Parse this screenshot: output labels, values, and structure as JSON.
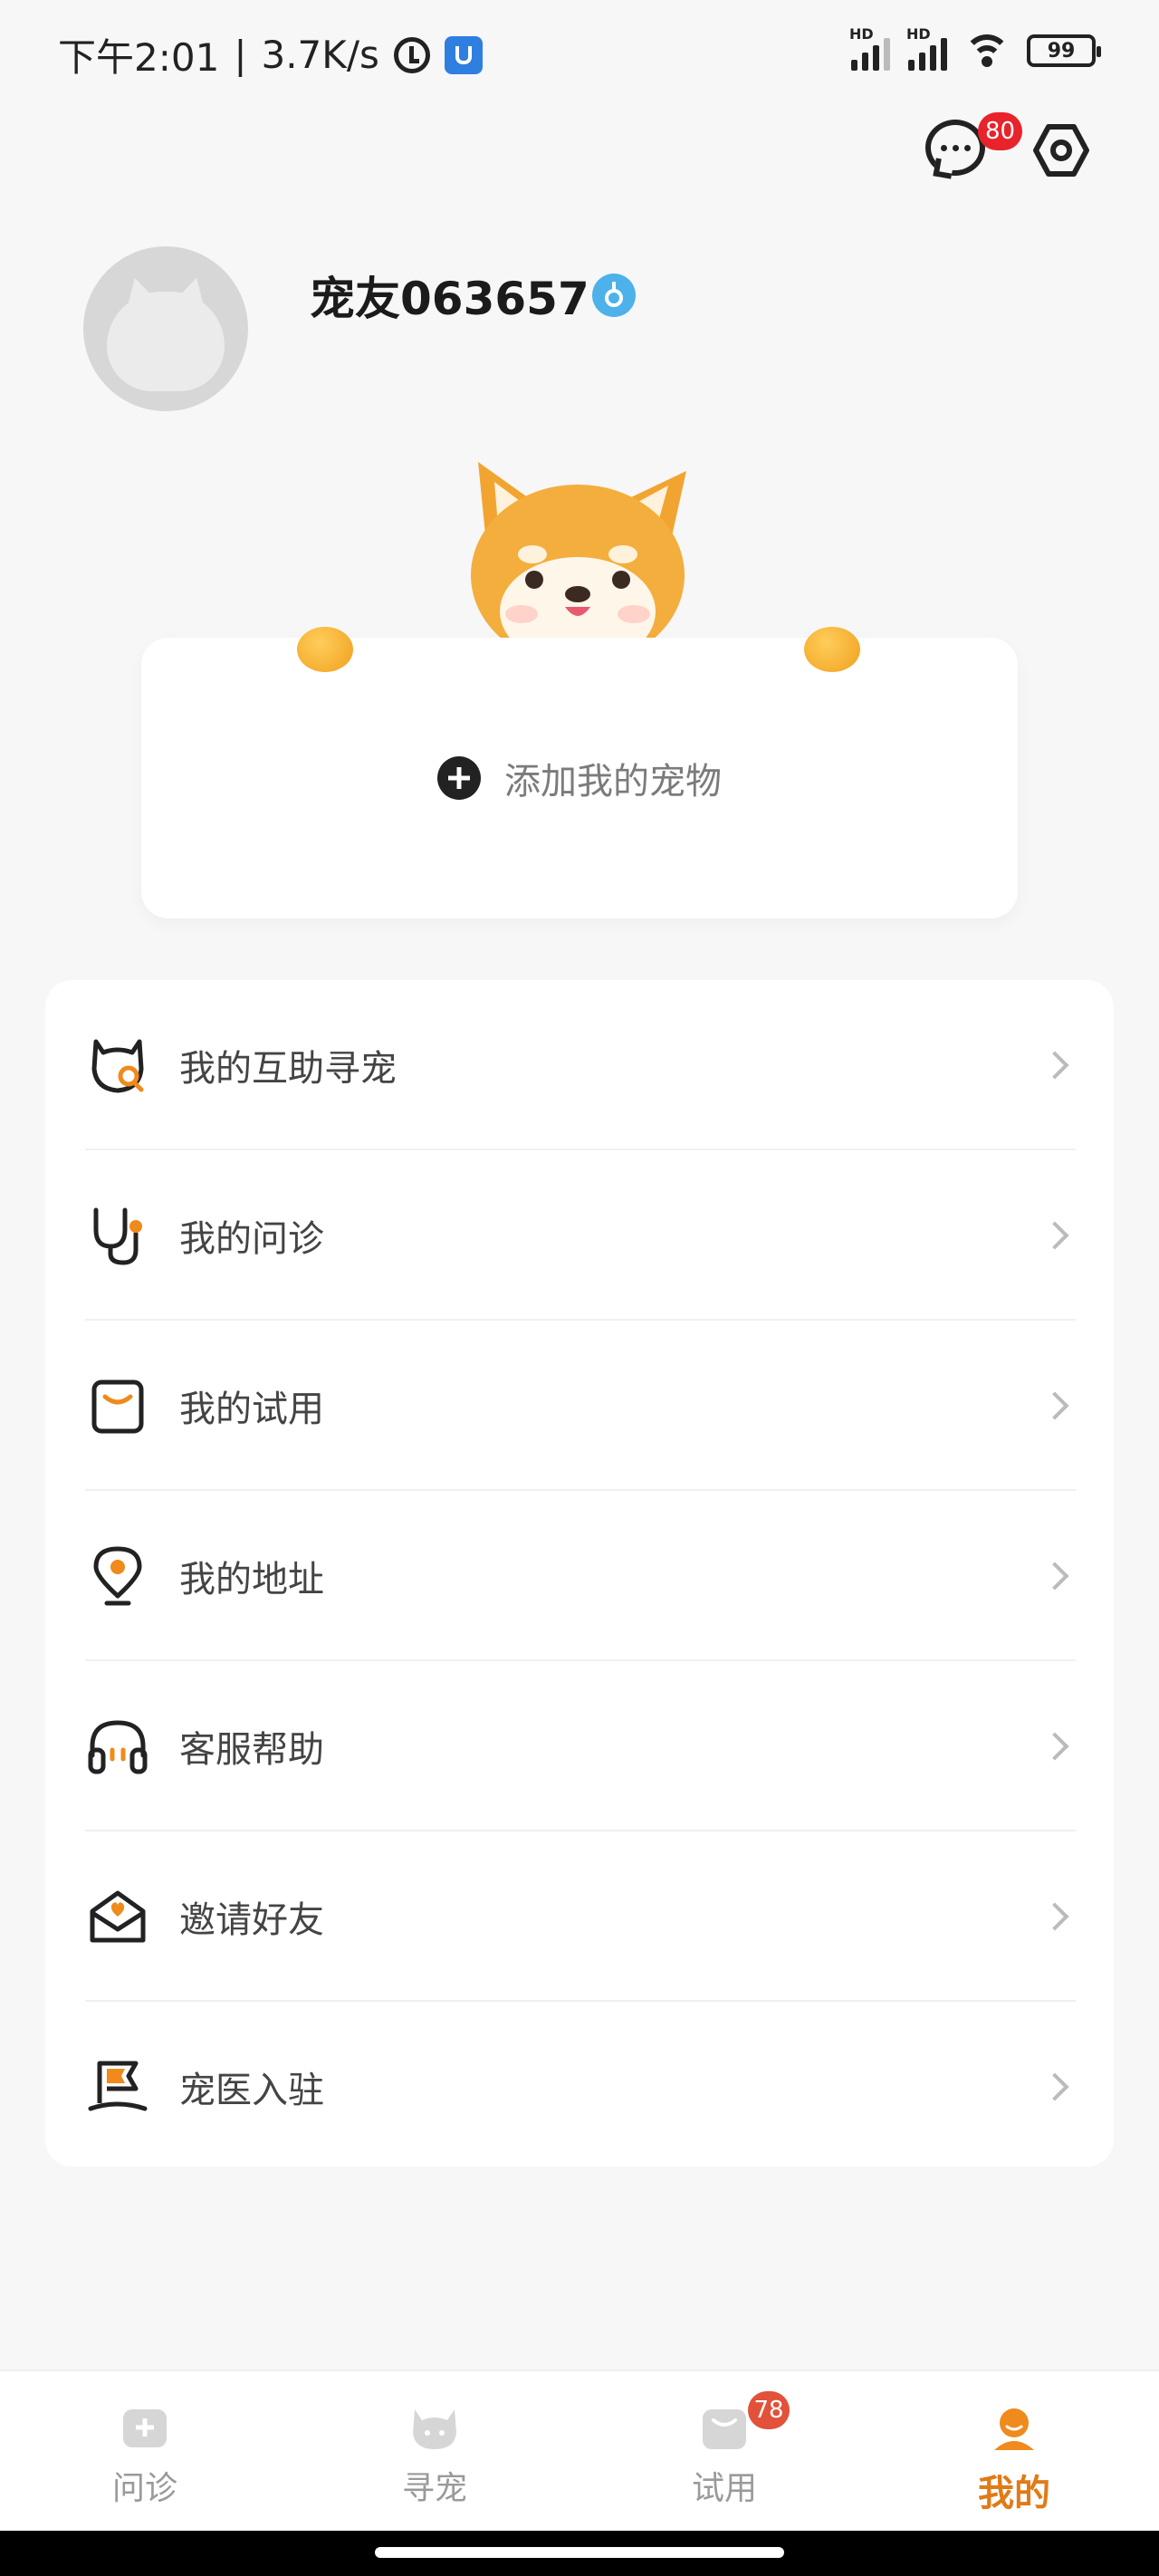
{
  "status_bar": {
    "time": "下午2:01",
    "net_speed": "3.7K/s",
    "signal_1_label": "HD",
    "signal_2_label": "HD",
    "battery": "99"
  },
  "header": {
    "messages_badge": "80",
    "messages_icon": "chat-bubble-icon",
    "settings_icon": "hexagon-gear-icon"
  },
  "profile": {
    "username": "宠友063657",
    "gender_icon": "male-symbol-icon"
  },
  "pet_card": {
    "add_label": "添加我的宠物"
  },
  "menu": {
    "items": [
      {
        "label": "我的互助寻宠",
        "icon": "cat-search-icon"
      },
      {
        "label": "我的问诊",
        "icon": "stethoscope-icon"
      },
      {
        "label": "我的试用",
        "icon": "bag-icon"
      },
      {
        "label": "我的地址",
        "icon": "location-pin-icon"
      },
      {
        "label": "客服帮助",
        "icon": "headset-icon"
      },
      {
        "label": "邀请好友",
        "icon": "invite-envelope-icon"
      },
      {
        "label": "宠医入驻",
        "icon": "flag-icon"
      }
    ]
  },
  "bottom_nav": {
    "tabs": [
      {
        "label": "问诊",
        "icon": "consult-icon"
      },
      {
        "label": "寻宠",
        "icon": "cat-face-icon"
      },
      {
        "label": "试用",
        "icon": "bag-icon",
        "badge": "78"
      },
      {
        "label": "我的",
        "icon": "profile-icon"
      }
    ],
    "active_color": "#e07b17"
  }
}
